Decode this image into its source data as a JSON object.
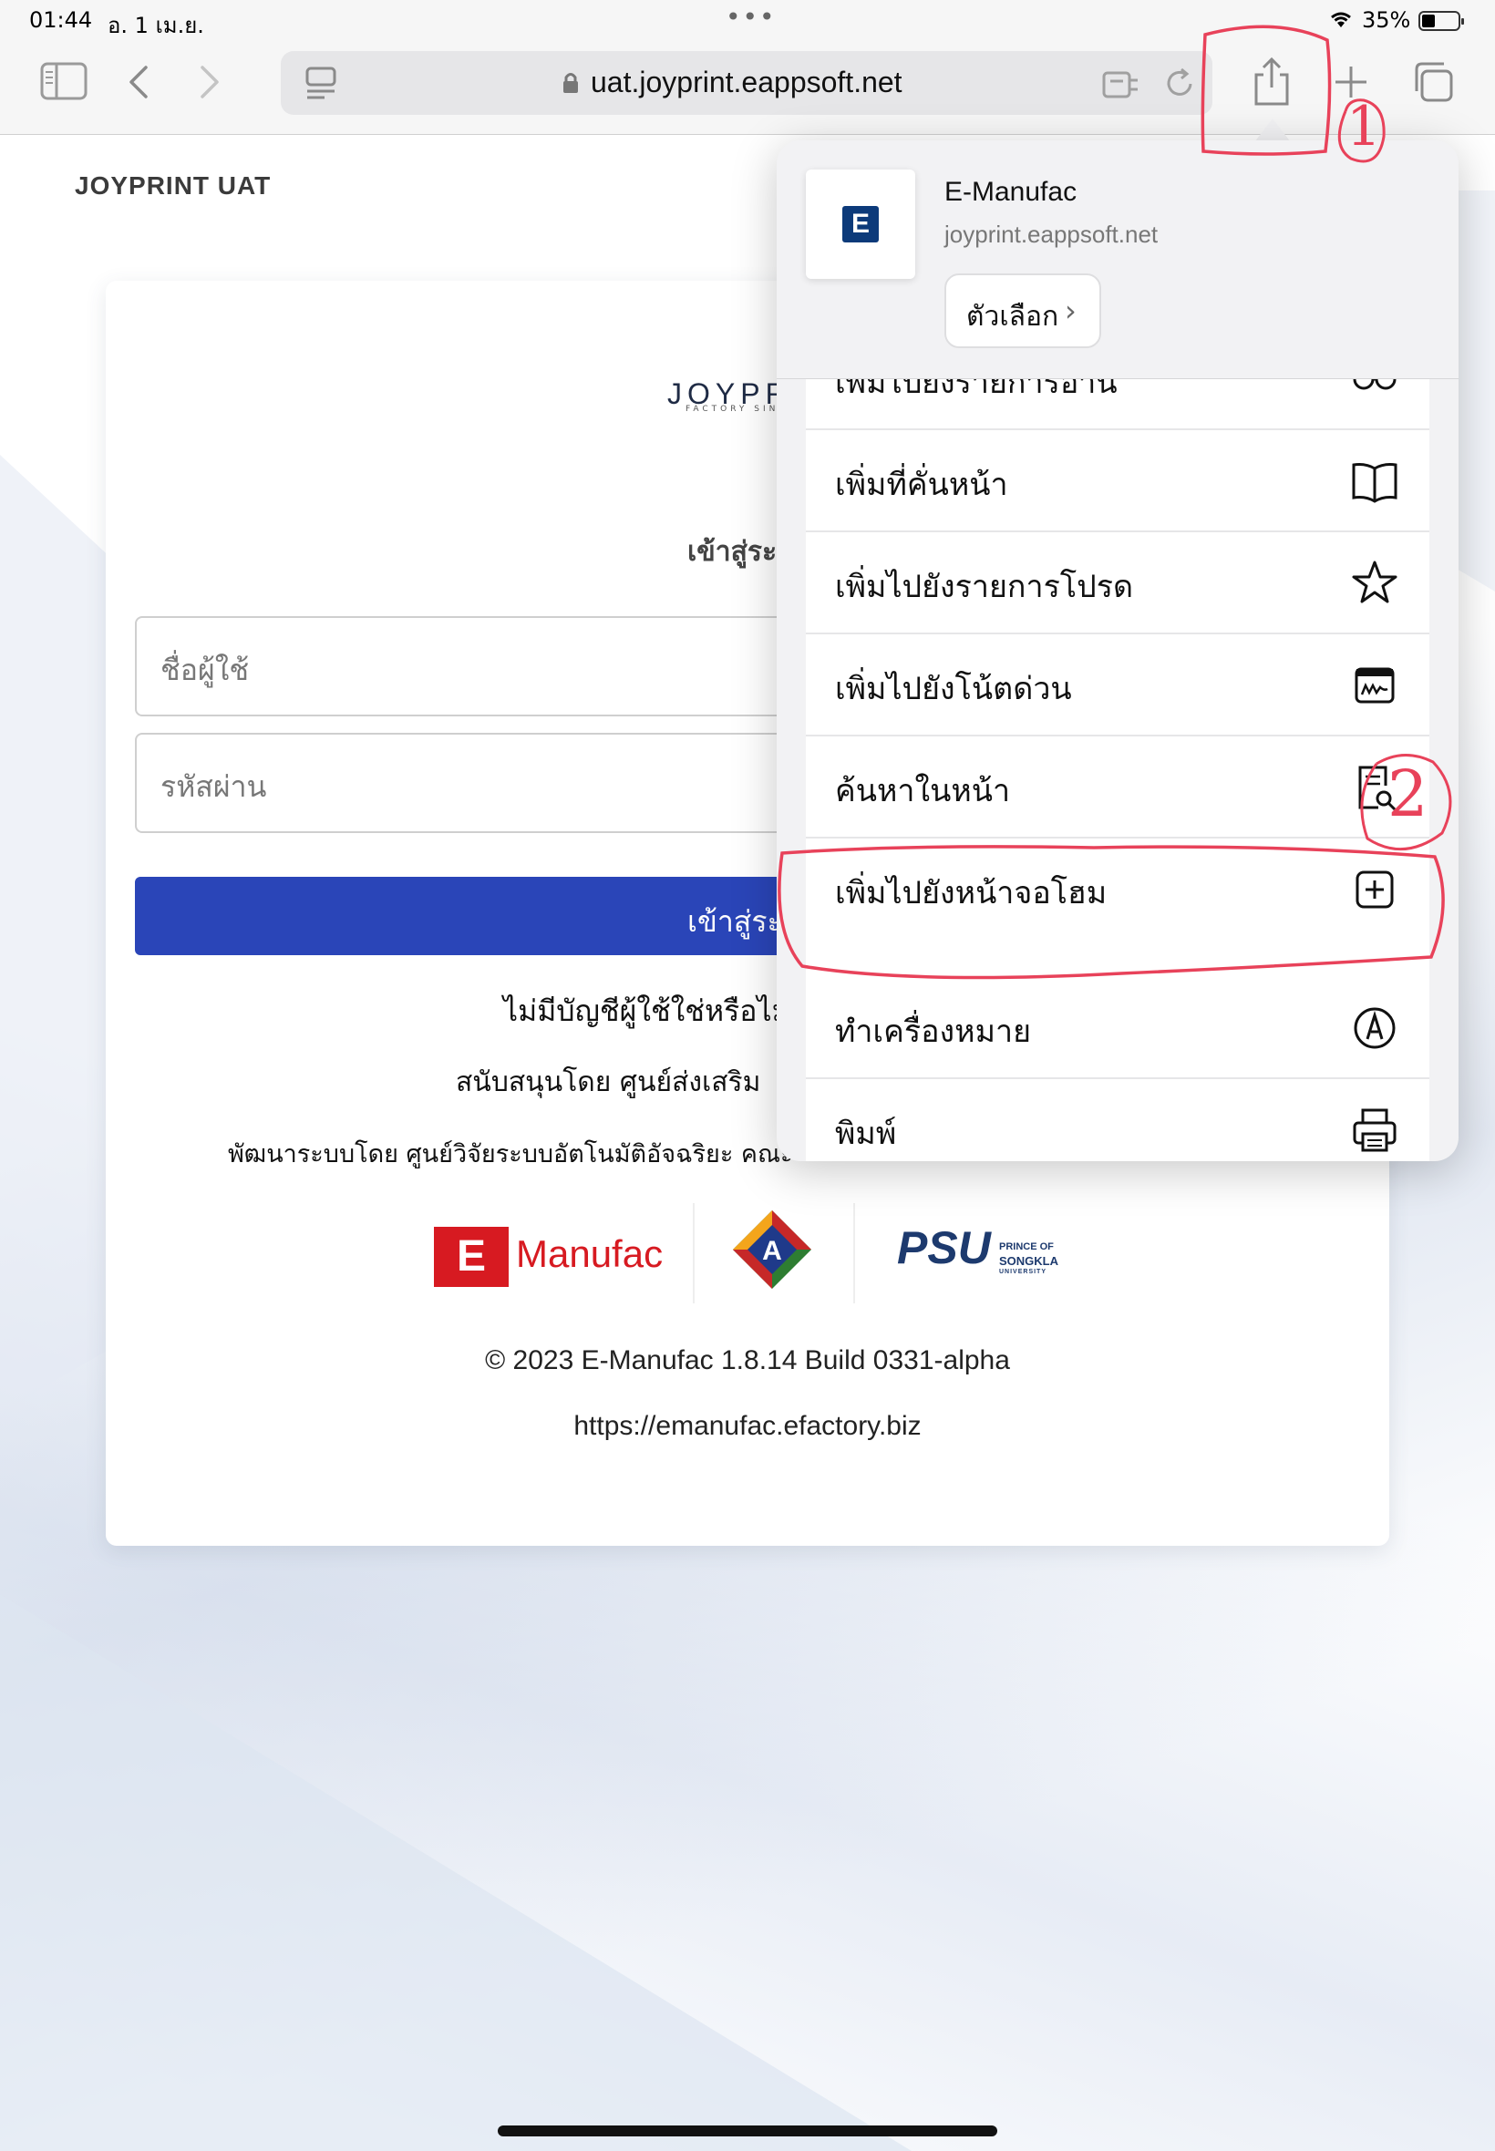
{
  "status": {
    "time": "01:44",
    "date": "อ. 1 เม.ย.",
    "battery": "35%"
  },
  "browser": {
    "url": "uat.joyprint.eappsoft.net"
  },
  "page": {
    "app_title": "JOYPRINT UAT",
    "logo_text": "JOYPR",
    "logo_sub": "FACTORY SINCE",
    "login_heading": "เข้าสู่ระบ",
    "username_placeholder": "ชื่อผู้ใช้",
    "password_placeholder": "รหัสผ่าน",
    "login_button": "เข้าสู่ระ",
    "no_account": "ไม่มีบัญชีผู้ใช้ใช่หรือไม่",
    "supported_by": "สนับสนุนโดย ศูนย์ส่งเสริม",
    "developed_by": "พัฒนาระบบโดย ศูนย์วิจัยระบบอัตโนมัติอัจฉริยะ คณะ",
    "emanufac_box": "E",
    "emanufac_text": "Manufac",
    "psu_text": "PSU",
    "psu_sub_1": "PRINCE OF",
    "psu_sub_2": "SONGKLA",
    "psu_sub_3": "UNIVERSITY",
    "copyright": "© 2023 E-Manufac 1.8.14 Build 0331-alpha",
    "site_url": "https://emanufac.efactory.biz"
  },
  "share_sheet": {
    "site_icon_letter": "E",
    "site_name": "E-Manufac",
    "site_domain": "joyprint.eappsoft.net",
    "options_label": "ตัวเลือก",
    "group1": [
      {
        "label": "เพิ่มไปยังรายการอ่าน",
        "icon": "glasses-icon"
      },
      {
        "label": "เพิ่มที่คั่นหน้า",
        "icon": "book-icon"
      },
      {
        "label": "เพิ่มไปยังรายการโปรด",
        "icon": "star-icon"
      },
      {
        "label": "เพิ่มไปยังโน้ตด่วน",
        "icon": "quick-note-icon"
      },
      {
        "label": "ค้นหาในหน้า",
        "icon": "find-in-page-icon"
      },
      {
        "label": "เพิ่มไปยังหน้าจอโฮม",
        "icon": "add-square-icon"
      }
    ],
    "group2": [
      {
        "label": "ทำเครื่องหมาย",
        "icon": "markup-icon"
      },
      {
        "label": "พิมพ์",
        "icon": "printer-icon"
      }
    ]
  },
  "annotations": {
    "step1": "1",
    "step2": "2",
    "color": "#e8425a"
  }
}
